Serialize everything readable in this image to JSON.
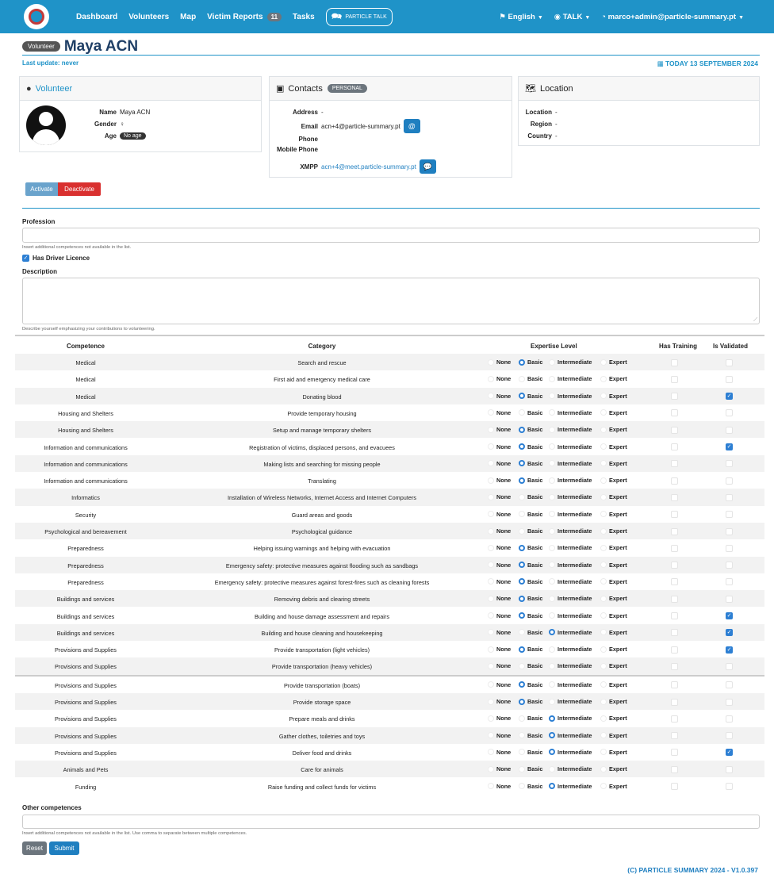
{
  "nav": {
    "items": [
      {
        "label": "Dashboard"
      },
      {
        "label": "Volunteers"
      },
      {
        "label": "Map"
      },
      {
        "label": "Victim Reports",
        "badge": "11"
      },
      {
        "label": "Tasks"
      }
    ],
    "talk_logo": "PARTICLE TALK",
    "language": "English",
    "talk": "TALK",
    "user": "marco+admin@particle-summary.pt"
  },
  "header": {
    "badge": "Volunteer",
    "title": "Maya ACN",
    "last_update": "Last update: never",
    "today": "TODAY 13 SEPTEMBER 2024"
  },
  "volunteer_card": {
    "title": "Volunteer",
    "name_label": "Name",
    "name": "Maya ACN",
    "gender_label": "Gender",
    "gender_symbol": "♀",
    "age_label": "Age",
    "age": "No age"
  },
  "contacts_card": {
    "title": "Contacts",
    "badge": "PERSONAL",
    "address_label": "Address",
    "address": "-",
    "email_label": "Email",
    "email": "acn+4@particle-summary.pt",
    "phone_label": "Phone",
    "phone": "",
    "mobile_label": "Mobile Phone",
    "mobile": "",
    "xmpp_label": "XMPP",
    "xmpp": "acn+4@meet.particle-summary.pt"
  },
  "location_card": {
    "title": "Location",
    "location_label": "Location",
    "location": "-",
    "region_label": "Region",
    "region": "-",
    "country_label": "Country",
    "country": "-"
  },
  "buttons": {
    "activate": "Activate",
    "deactivate": "Deactivate",
    "reset": "Reset",
    "submit": "Submit"
  },
  "form": {
    "profession_label": "Profession",
    "profession_help": "Insert additional competences not available in the list.",
    "driver_licence_label": "Has Driver Licence",
    "driver_licence_checked": true,
    "description_label": "Description",
    "description_help": "Describe yourself emphasizing your contributions to volunteering.",
    "other_label": "Other competences",
    "other_help": "Insert additional competences not available in the list. Use comma to separate between multiple competences."
  },
  "table": {
    "headers": {
      "competence": "Competence",
      "category": "Category",
      "expertise": "Expertise Level",
      "training": "Has Training",
      "validated": "Is Validated"
    },
    "levels": [
      "None",
      "Basic",
      "Intermediate",
      "Expert"
    ],
    "rows": [
      {
        "competence": "Medical",
        "category": "Search and rescue",
        "level": "Basic",
        "training": false,
        "validated": false
      },
      {
        "competence": "Medical",
        "category": "First aid and emergency medical care",
        "level": "",
        "training": false,
        "validated": false
      },
      {
        "competence": "Medical",
        "category": "Donating blood",
        "level": "Basic",
        "training": false,
        "validated": true
      },
      {
        "competence": "Housing and Shelters",
        "category": "Provide temporary housing",
        "level": "",
        "training": false,
        "validated": false
      },
      {
        "competence": "Housing and Shelters",
        "category": "Setup and manage temporary shelters",
        "level": "Basic",
        "training": false,
        "validated": false
      },
      {
        "competence": "Information and communications",
        "category": "Registration of victims, displaced persons, and evacuees",
        "level": "Basic",
        "training": false,
        "validated": true
      },
      {
        "competence": "Information and communications",
        "category": "Making lists and searching for missing people",
        "level": "Basic",
        "training": false,
        "validated": false
      },
      {
        "competence": "Information and communications",
        "category": "Translating",
        "level": "Basic",
        "training": false,
        "validated": false
      },
      {
        "competence": "Informatics",
        "category": "Installation of Wireless Networks, Internet Access and Internet Computers",
        "level": "",
        "training": false,
        "validated": false
      },
      {
        "competence": "Security",
        "category": "Guard areas and goods",
        "level": "",
        "training": false,
        "validated": false
      },
      {
        "competence": "Psychological and bereavement",
        "category": "Psychological guidance",
        "level": "",
        "training": false,
        "validated": false
      },
      {
        "competence": "Preparedness",
        "category": "Helping issuing warnings and helping with evacuation",
        "level": "Basic",
        "training": false,
        "validated": false
      },
      {
        "competence": "Preparedness",
        "category": "Emergency safety: protective measures against flooding such as sandbags",
        "level": "Basic",
        "training": false,
        "validated": false
      },
      {
        "competence": "Preparedness",
        "category": "Emergency safety: protective measures against forest-fires such as cleaning forests",
        "level": "Basic",
        "training": false,
        "validated": false
      },
      {
        "competence": "Buildings and services",
        "category": "Removing debris and clearing streets",
        "level": "Basic",
        "training": false,
        "validated": false
      },
      {
        "competence": "Buildings and services",
        "category": "Building and house damage assessment and repairs",
        "level": "Basic",
        "training": false,
        "validated": true
      },
      {
        "competence": "Buildings and services",
        "category": "Building and house cleaning and housekeeping",
        "level": "Intermediate",
        "training": false,
        "validated": true
      },
      {
        "competence": "Provisions and Supplies",
        "category": "Provide transportation (light vehicles)",
        "level": "Basic",
        "training": false,
        "validated": true
      },
      {
        "competence": "Provisions and Supplies",
        "category": "Provide transportation (heavy vehicles)",
        "level": "",
        "training": false,
        "validated": false
      },
      {
        "competence": "Provisions and Supplies",
        "category": "Provide transportation (boats)",
        "level": "Basic",
        "training": false,
        "validated": false
      },
      {
        "competence": "Provisions and Supplies",
        "category": "Provide storage space",
        "level": "Basic",
        "training": false,
        "validated": false
      },
      {
        "competence": "Provisions and Supplies",
        "category": "Prepare meals and drinks",
        "level": "Intermediate",
        "training": false,
        "validated": false
      },
      {
        "competence": "Provisions and Supplies",
        "category": "Gather clothes, toiletries and toys",
        "level": "Intermediate",
        "training": false,
        "validated": false
      },
      {
        "competence": "Provisions and Supplies",
        "category": "Deliver food and drinks",
        "level": "Intermediate",
        "training": false,
        "validated": true
      },
      {
        "competence": "Animals and Pets",
        "category": "Care for animals",
        "level": "",
        "training": false,
        "validated": false
      },
      {
        "competence": "Funding",
        "category": "Raise funding and collect funds for victims",
        "level": "Intermediate",
        "training": false,
        "validated": false
      }
    ]
  },
  "footer": "(C) PARTICLE SUMMARY 2024 - V1.0.397"
}
